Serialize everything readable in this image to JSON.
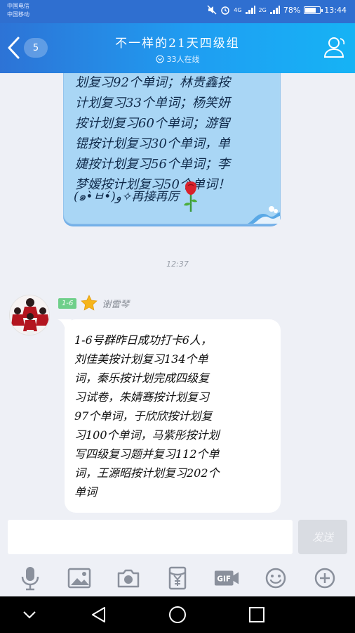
{
  "status_bar": {
    "carrier_1": "中国电信",
    "carrier_2": "中国移动",
    "network_1": "4G",
    "network_2": "2G",
    "battery": "78%",
    "battery_level": 0.78,
    "time": "13:44"
  },
  "header": {
    "unread_count": "5",
    "title": "不一样的21天四级组",
    "online": "33人在线"
  },
  "messages": [
    {
      "lines": [
        "划复习92个单词；林贵鑫按",
        "计划复习33个单词；杨笑妍",
        "按计划复习60个单词；游智",
        "锟按计划复习30个单词，单",
        "婕按计划复习56个单词；李",
        "梦嫒按计划复习50个单词！"
      ],
      "footer": "(๑•̀ㅂ•́)و✧再接再厉"
    },
    {
      "timestamp": "12:37"
    },
    {
      "sender_tag": "1-6",
      "sender_name": "谢雷琴",
      "lines": [
        "1-6号群昨日成功打卡6人，",
        "刘佳美按计划复习134个单",
        "词，秦乐按计划完成四级复",
        "习试卷，朱婧骞按计划复习",
        "97个单词，于欣欣按计划复",
        "习100个单词，马紫彤按计划",
        "写四级复习题并复习112个单",
        "词，王源昭按计划复习202个",
        "单词"
      ]
    }
  ],
  "composer": {
    "value": "",
    "send_label": "发送"
  },
  "toolbar": [
    "microphone-icon",
    "image-icon",
    "camera-icon",
    "red-packet-icon",
    "gif-icon",
    "emoji-icon",
    "plus-icon"
  ],
  "colors": {
    "header_start": "#2d73d6",
    "header_end": "#16b3f5",
    "self_bubble": "#a9d6f5",
    "tag": "#6fcf8a"
  }
}
